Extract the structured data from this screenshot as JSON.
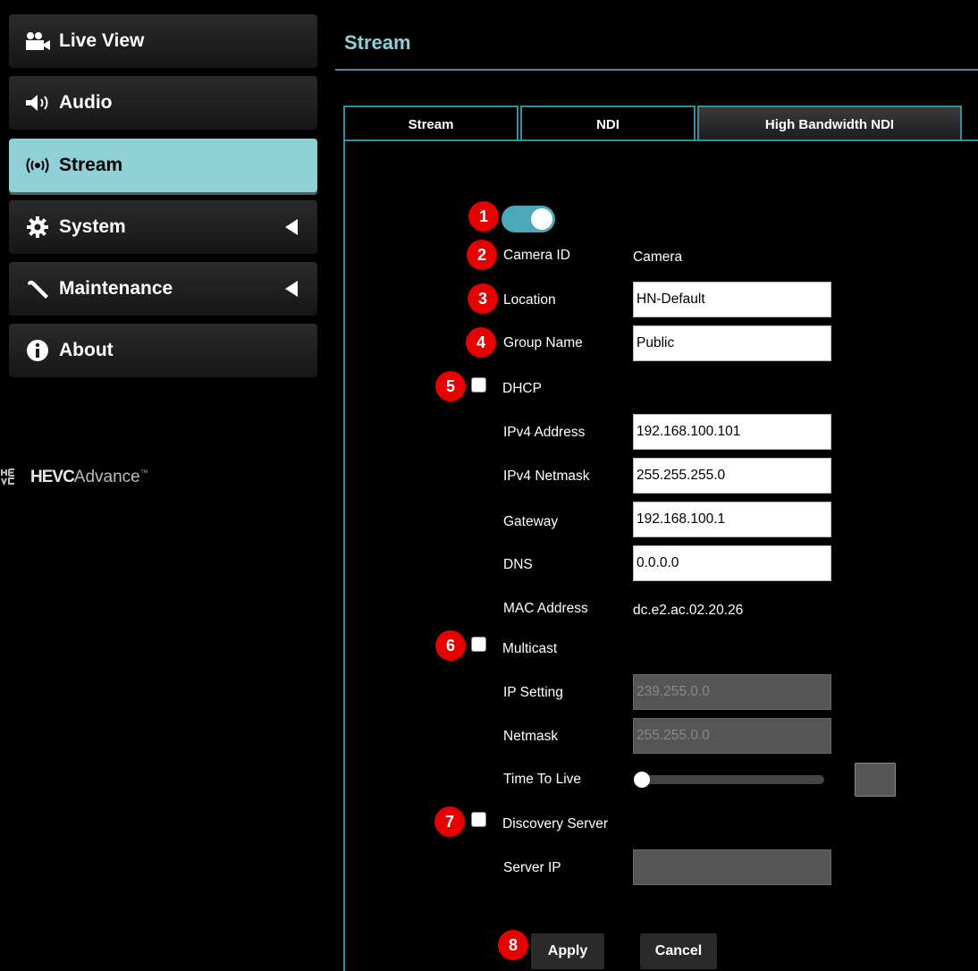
{
  "sidebar": {
    "items": [
      {
        "label": "Live View",
        "icon": "video-camera-icon",
        "active": false,
        "expandable": false
      },
      {
        "label": "Audio",
        "icon": "speaker-icon",
        "active": false,
        "expandable": false
      },
      {
        "label": "Stream",
        "icon": "broadcast-icon",
        "active": true,
        "expandable": false
      },
      {
        "label": "System",
        "icon": "gear-icon",
        "active": false,
        "expandable": true
      },
      {
        "label": "Maintenance",
        "icon": "wrench-icon",
        "active": false,
        "expandable": true
      },
      {
        "label": "About",
        "icon": "info-icon",
        "active": false,
        "expandable": false
      }
    ],
    "logo": {
      "badge": "HE VC",
      "brand_bold": "HEVC",
      "brand_light": "Advance",
      "trademark": "™"
    }
  },
  "page": {
    "title": "Stream"
  },
  "tabs": [
    {
      "label": "Stream",
      "active": false
    },
    {
      "label": "NDI",
      "active": false
    },
    {
      "label": "High Bandwidth NDI",
      "active": true
    }
  ],
  "form": {
    "enable_toggle": {
      "on": true
    },
    "camera_id": {
      "label": "Camera ID",
      "value": "Camera"
    },
    "location": {
      "label": "Location",
      "value": "HN-Default"
    },
    "group_name": {
      "label": "Group Name",
      "value": "Public"
    },
    "dhcp": {
      "label": "DHCP",
      "checked": false
    },
    "ipv4_address": {
      "label": "IPv4 Address",
      "value": "192.168.100.101"
    },
    "ipv4_netmask": {
      "label": "IPv4 Netmask",
      "value": "255.255.255.0"
    },
    "gateway": {
      "label": "Gateway",
      "value": "192.168.100.1"
    },
    "dns": {
      "label": "DNS",
      "value": "0.0.0.0"
    },
    "mac_address": {
      "label": "MAC Address",
      "value": "dc.e2.ac.02.20.26"
    },
    "multicast": {
      "label": "Multicast",
      "checked": false
    },
    "ip_setting": {
      "label": "IP Setting",
      "value": "239.255.0.0"
    },
    "netmask": {
      "label": "Netmask",
      "value": "255.255.0.0"
    },
    "time_to_live": {
      "label": "Time To Live",
      "value": ""
    },
    "discovery_server": {
      "label": "Discovery Server",
      "checked": false
    },
    "server_ip": {
      "label": "Server IP",
      "value": ""
    },
    "apply_label": "Apply",
    "cancel_label": "Cancel"
  },
  "markers": [
    "1",
    "2",
    "3",
    "4",
    "5",
    "6",
    "7",
    "8"
  ],
  "colors": {
    "accent": "#8fcfd6",
    "tab_border": "#3b8ca3",
    "marker": "#e60000",
    "toggle": "#4aa8b8"
  }
}
